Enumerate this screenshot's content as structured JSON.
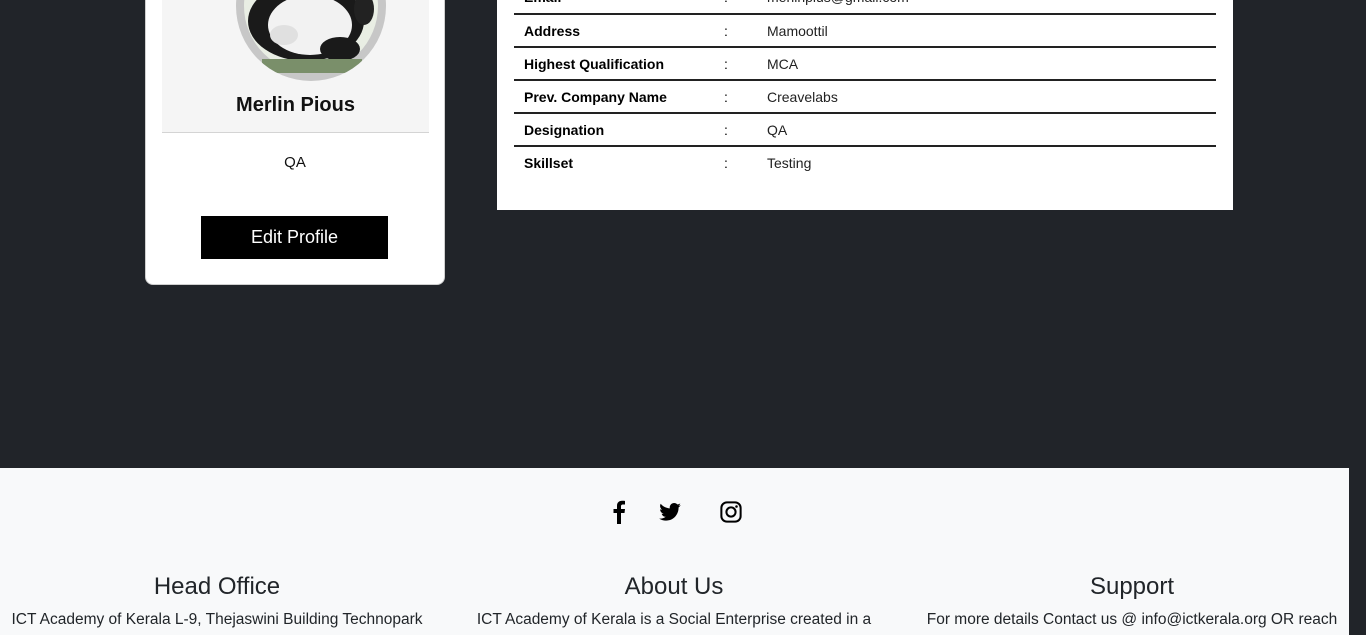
{
  "profile": {
    "name": "Merlin Pious",
    "role": "QA",
    "edit_label": "Edit Profile"
  },
  "details": {
    "partial_row": {
      "label": "Email",
      "value": "merlinpius@gmail.com"
    },
    "rows": [
      {
        "label": "Address",
        "sep": ":",
        "value": "Mamoottil"
      },
      {
        "label": "Highest Qualification",
        "sep": ":",
        "value": "MCA"
      },
      {
        "label": "Prev. Company Name",
        "sep": ":",
        "value": "Creavelabs"
      },
      {
        "label": "Designation",
        "sep": ":",
        "value": "QA"
      },
      {
        "label": "Skillset",
        "sep": ":",
        "value": "Testing"
      }
    ]
  },
  "footer": {
    "socials": [
      "facebook-icon",
      "twitter-icon",
      "instagram-icon"
    ],
    "head_office": {
      "title": "Head Office",
      "text": "ICT Academy of Kerala L-9, Thejaswini Building Technopark"
    },
    "about": {
      "title": "About Us",
      "text": "ICT Academy of Kerala is a Social Enterprise created in a"
    },
    "support": {
      "title": "Support",
      "text": "For more details Contact us @ info@ictkerala.org OR reach"
    }
  },
  "colors": {
    "page_bg": "#212429",
    "footer_bg": "#f8f9fa",
    "button_bg": "#000000"
  }
}
